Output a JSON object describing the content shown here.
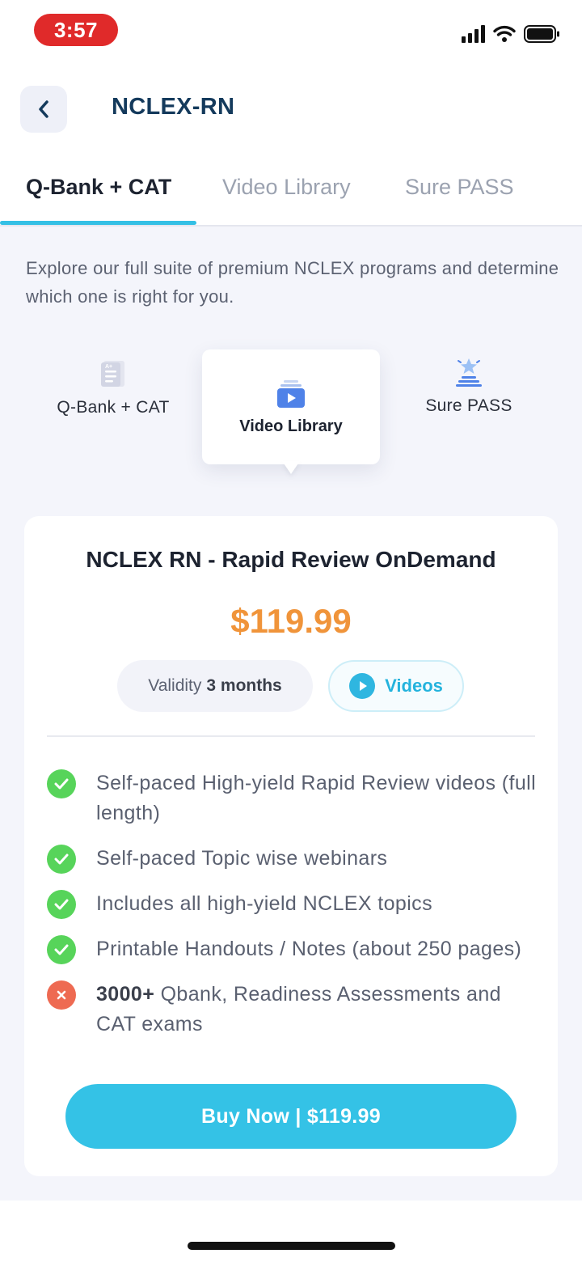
{
  "status_bar": {
    "time": "3:57"
  },
  "header": {
    "title": "NCLEX-RN"
  },
  "tabs": [
    {
      "label": "Q-Bank + CAT",
      "active": true
    },
    {
      "label": "Video Library",
      "active": false
    },
    {
      "label": "Sure PASS",
      "active": false
    }
  ],
  "intro": "Explore our full suite of premium NCLEX programs and determine which one is right for you.",
  "plans": {
    "qbank": "Q-Bank + CAT",
    "video": "Video Library",
    "surepass": "Sure PASS",
    "selected": "Video Library"
  },
  "product": {
    "name": "NCLEX RN - Rapid Review OnDemand",
    "price": "$119.99",
    "validity_label": "Validity",
    "validity_value": "3 months",
    "media_label": "Videos",
    "features": [
      {
        "text": "Self-paced High-yield Rapid Review videos (full length)",
        "included": true
      },
      {
        "text": "Self-paced Topic wise webinars",
        "included": true
      },
      {
        "text": "Includes all high-yield NCLEX topics",
        "included": true
      },
      {
        "text": "Printable Handouts / Notes (about 250 pages)",
        "included": true
      },
      {
        "bold": "3000+",
        "text": "Qbank, Readiness Assessments and CAT exams",
        "included": false
      }
    ],
    "buy_label": "Buy Now | $119.99"
  },
  "colors": {
    "accent": "#34c0e5",
    "price": "#f0943a",
    "included": "#57d45a",
    "excluded": "#ee6a52",
    "title": "#143a5c"
  }
}
